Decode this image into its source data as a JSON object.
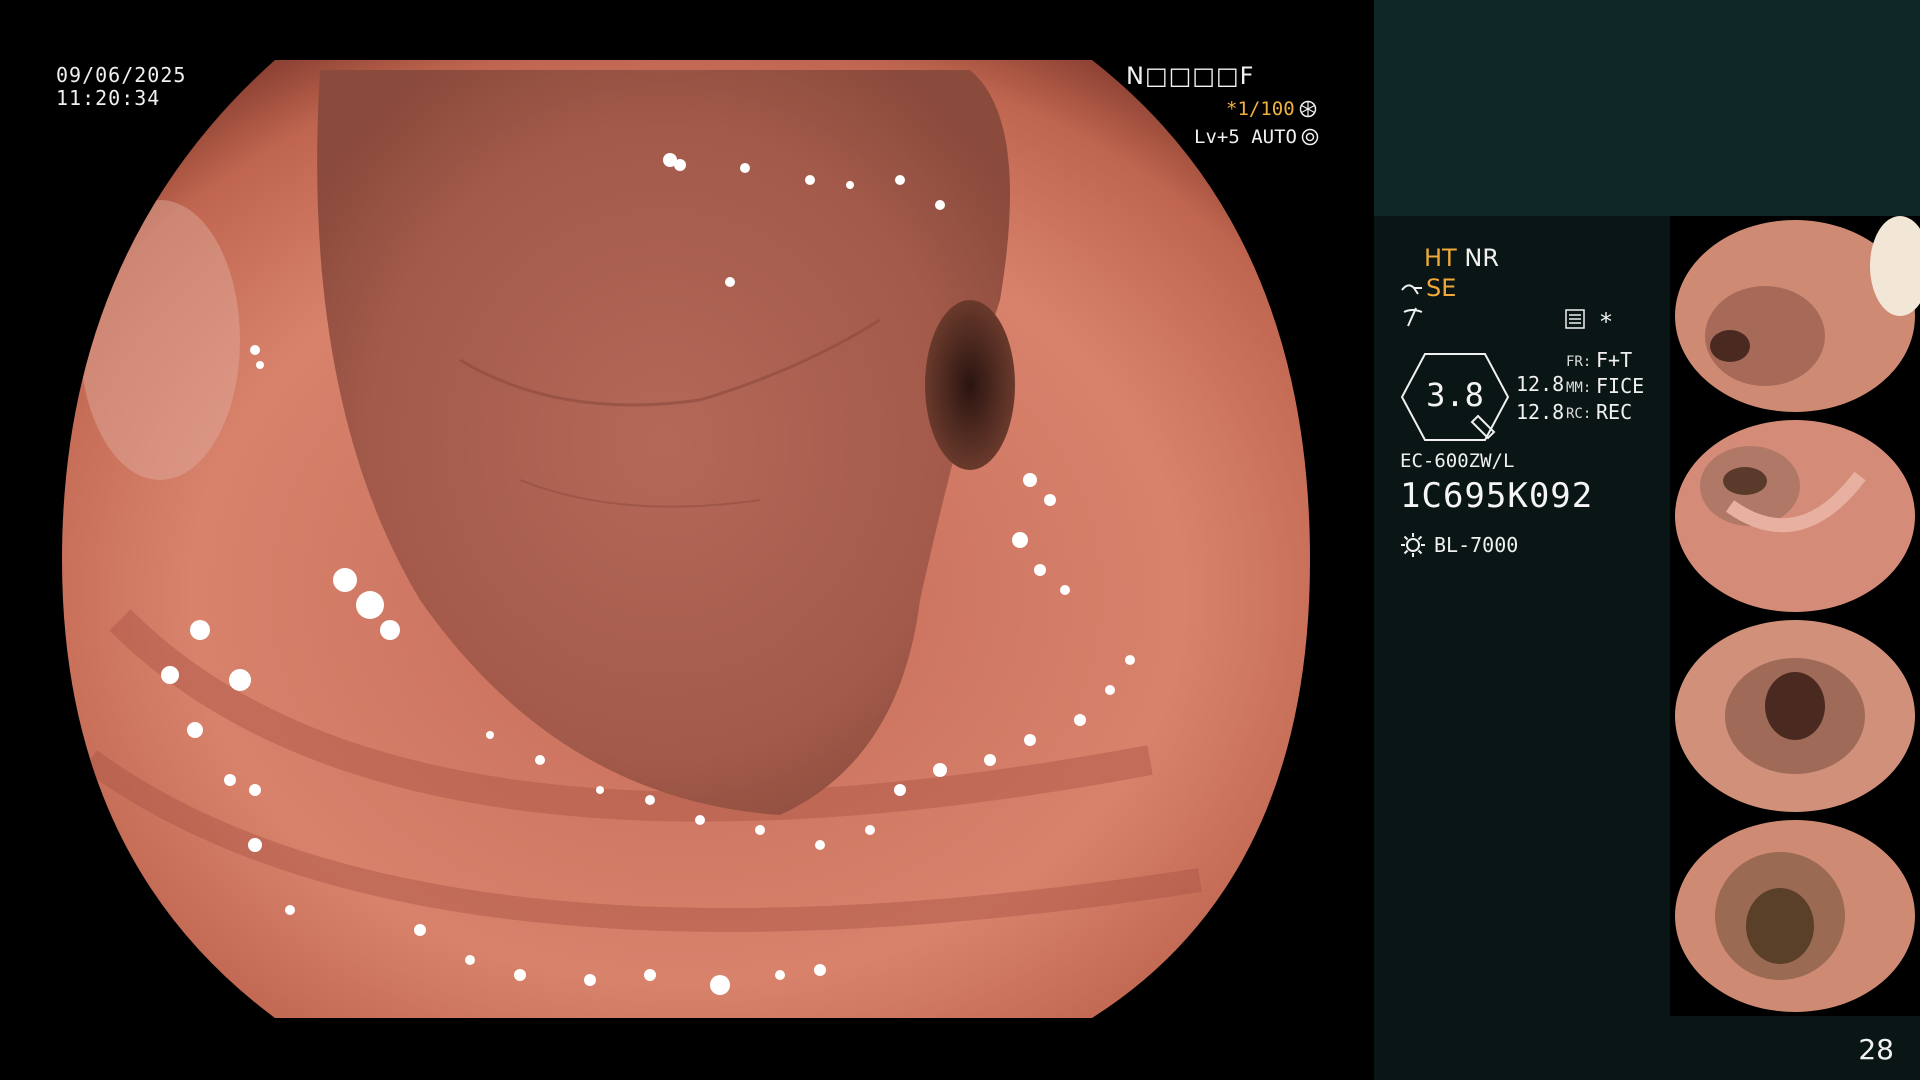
{
  "overlay": {
    "date": "09/06/2025",
    "time": "11:20:34",
    "id_code": "N□□□□F",
    "shutter": "*1/100",
    "level": "Lv+5 AUTO"
  },
  "panel": {
    "mode_ht": "HT",
    "mode_nr": "NR",
    "mode_se": "SE",
    "asterisk": "*",
    "gauge_value": "3.8",
    "param1": "12.8",
    "param2": "12.8",
    "fr_key": "FR:",
    "fr_val": "F+T",
    "mm_key": "MM:",
    "mm_val": "FICE",
    "rc_key": "RC:",
    "rc_val": "REC",
    "scope_model": "EC-600ZW/L",
    "scope_serial": "1C695K092",
    "light_source": "BL-7000",
    "page_number": "28"
  },
  "thumbnails": [
    {
      "label": "thumbnail 1"
    },
    {
      "label": "thumbnail 2"
    },
    {
      "label": "thumbnail 3"
    },
    {
      "label": "thumbnail 4"
    }
  ],
  "icons": {
    "shutter": "aperture-icon",
    "level": "iris-icon",
    "mode_se": "scope-tip-icon",
    "mode3": "curve-slash-icon",
    "image_settings": "settings-list-icon",
    "light": "sun-icon"
  },
  "colors": {
    "panel_bg": "#0a1616",
    "panel_top": "#0e2727",
    "accent_orange": "#f0a83a",
    "mucosa": "#c87060"
  }
}
